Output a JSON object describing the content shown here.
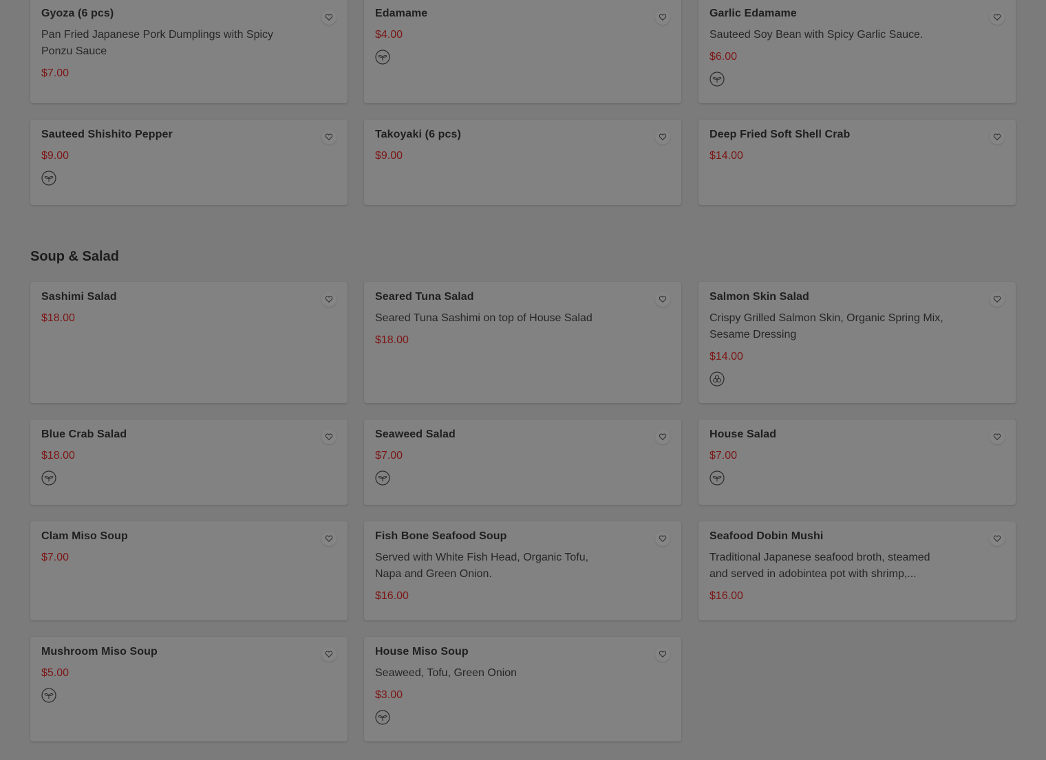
{
  "sections": [
    {
      "title": "",
      "items": [
        {
          "name": "Gyoza (6 pcs)",
          "description": "Pan Fried Japanese Pork Dumplings with Spicy Ponzu Sauce",
          "price": "$7.00",
          "diet_icon": ""
        },
        {
          "name": "Edamame",
          "description": "",
          "price": "$4.00",
          "diet_icon": "vegan-sprout-icon"
        },
        {
          "name": "Garlic Edamame",
          "description": "Sauteed Soy Bean with Spicy Garlic Sauce.",
          "price": "$6.00",
          "diet_icon": "vegan-sprout-icon"
        },
        {
          "name": "Sauteed Shishito Pepper",
          "description": "",
          "price": "$9.00",
          "diet_icon": "vegan-sprout-icon"
        },
        {
          "name": "Takoyaki (6 pcs)",
          "description": "",
          "price": "$9.00",
          "diet_icon": ""
        },
        {
          "name": "Deep Fried Soft Shell Crab",
          "description": "",
          "price": "$14.00",
          "diet_icon": ""
        }
      ]
    },
    {
      "title": "Soup & Salad",
      "items": [
        {
          "name": "Sashimi Salad",
          "description": "",
          "price": "$18.00",
          "diet_icon": ""
        },
        {
          "name": "Seared Tuna Salad",
          "description": "Seared Tuna Sashimi on top of House Salad",
          "price": "$18.00",
          "diet_icon": ""
        },
        {
          "name": "Salmon Skin Salad",
          "description": "Crispy Grilled Salmon Skin, Organic Spring Mix, Sesame Dressing",
          "price": "$14.00",
          "diet_icon": "organic-leaf-icon"
        },
        {
          "name": "Blue Crab Salad",
          "description": "",
          "price": "$18.00",
          "diet_icon": "vegan-sprout-icon"
        },
        {
          "name": "Seaweed Salad",
          "description": "",
          "price": "$7.00",
          "diet_icon": "vegan-sprout-icon"
        },
        {
          "name": "House Salad",
          "description": "",
          "price": "$7.00",
          "diet_icon": "vegan-sprout-icon"
        },
        {
          "name": "Clam Miso Soup",
          "description": "",
          "price": "$7.00",
          "diet_icon": ""
        },
        {
          "name": "Fish Bone Seafood Soup",
          "description": "Served with White Fish Head, Organic Tofu, Napa and Green Onion.",
          "price": "$16.00",
          "diet_icon": ""
        },
        {
          "name": "Seafood Dobin Mushi",
          "description": "Traditional Japanese seafood broth, steamed and served in adobintea pot with shrimp,...",
          "price": "$16.00",
          "diet_icon": ""
        },
        {
          "name": "Mushroom Miso Soup",
          "description": "",
          "price": "$5.00",
          "diet_icon": "vegan-sprout-icon"
        },
        {
          "name": "House Miso Soup",
          "description": "Seaweed, Tofu, Green Onion",
          "price": "$3.00",
          "diet_icon": "vegan-sprout-icon"
        }
      ]
    }
  ],
  "favorite_icon": "heart-outline-icon",
  "colors": {
    "overlay_background": "#7b7b7b",
    "card": "#828282",
    "price": "#7d1616",
    "text": "#1f1f1f"
  }
}
